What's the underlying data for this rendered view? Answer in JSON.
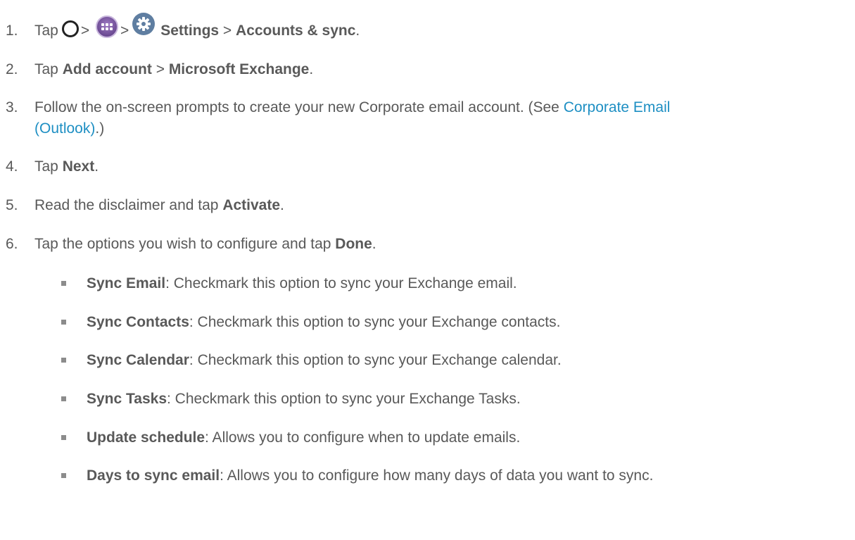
{
  "steps": [
    {
      "num": "1.",
      "pre": "Tap",
      "sep1": ">",
      "sep2": ">",
      "settings": "Settings",
      "sep3": ">",
      "accounts": "Accounts & sync",
      "end": "."
    },
    {
      "num": "2.",
      "pre": "Tap ",
      "b1": "Add account",
      "mid": " > ",
      "b2": "Microsoft Exchange",
      "end": "."
    },
    {
      "num": "3.",
      "line1": "Follow the on-screen prompts to create your new Corporate email account. (See ",
      "link1": "Corporate Email",
      "link2": "(Outlook)",
      "line2_end": ".)"
    },
    {
      "num": "4.",
      "pre": "Tap ",
      "b1": "Next",
      "end": "."
    },
    {
      "num": "5.",
      "pre": "Read the disclaimer and tap ",
      "b1": "Activate",
      "end": "."
    },
    {
      "num": "6.",
      "pre": "Tap the options you wish to configure and tap ",
      "b1": "Done",
      "end": "."
    }
  ],
  "options": [
    {
      "label": "Sync Email",
      "desc": ": Checkmark this option to sync your Exchange email."
    },
    {
      "label": "Sync Contacts",
      "desc": ": Checkmark this option to sync your Exchange contacts."
    },
    {
      "label": "Sync Calendar",
      "desc": ": Checkmark this option to sync your Exchange calendar."
    },
    {
      "label": "Sync Tasks",
      "desc": ": Checkmark this option to sync your Exchange Tasks."
    },
    {
      "label": "Update schedule",
      "desc": ": Allows you to configure when to update emails."
    },
    {
      "label": "Days to sync email",
      "desc": ": Allows you to configure how many days of data you want to sync."
    }
  ],
  "icons": [
    "home-icon",
    "apps-icon",
    "settings-icon"
  ],
  "colors": {
    "text": "#595959",
    "link": "#1e8fc3",
    "settings_icon": "#5f7ea1"
  }
}
